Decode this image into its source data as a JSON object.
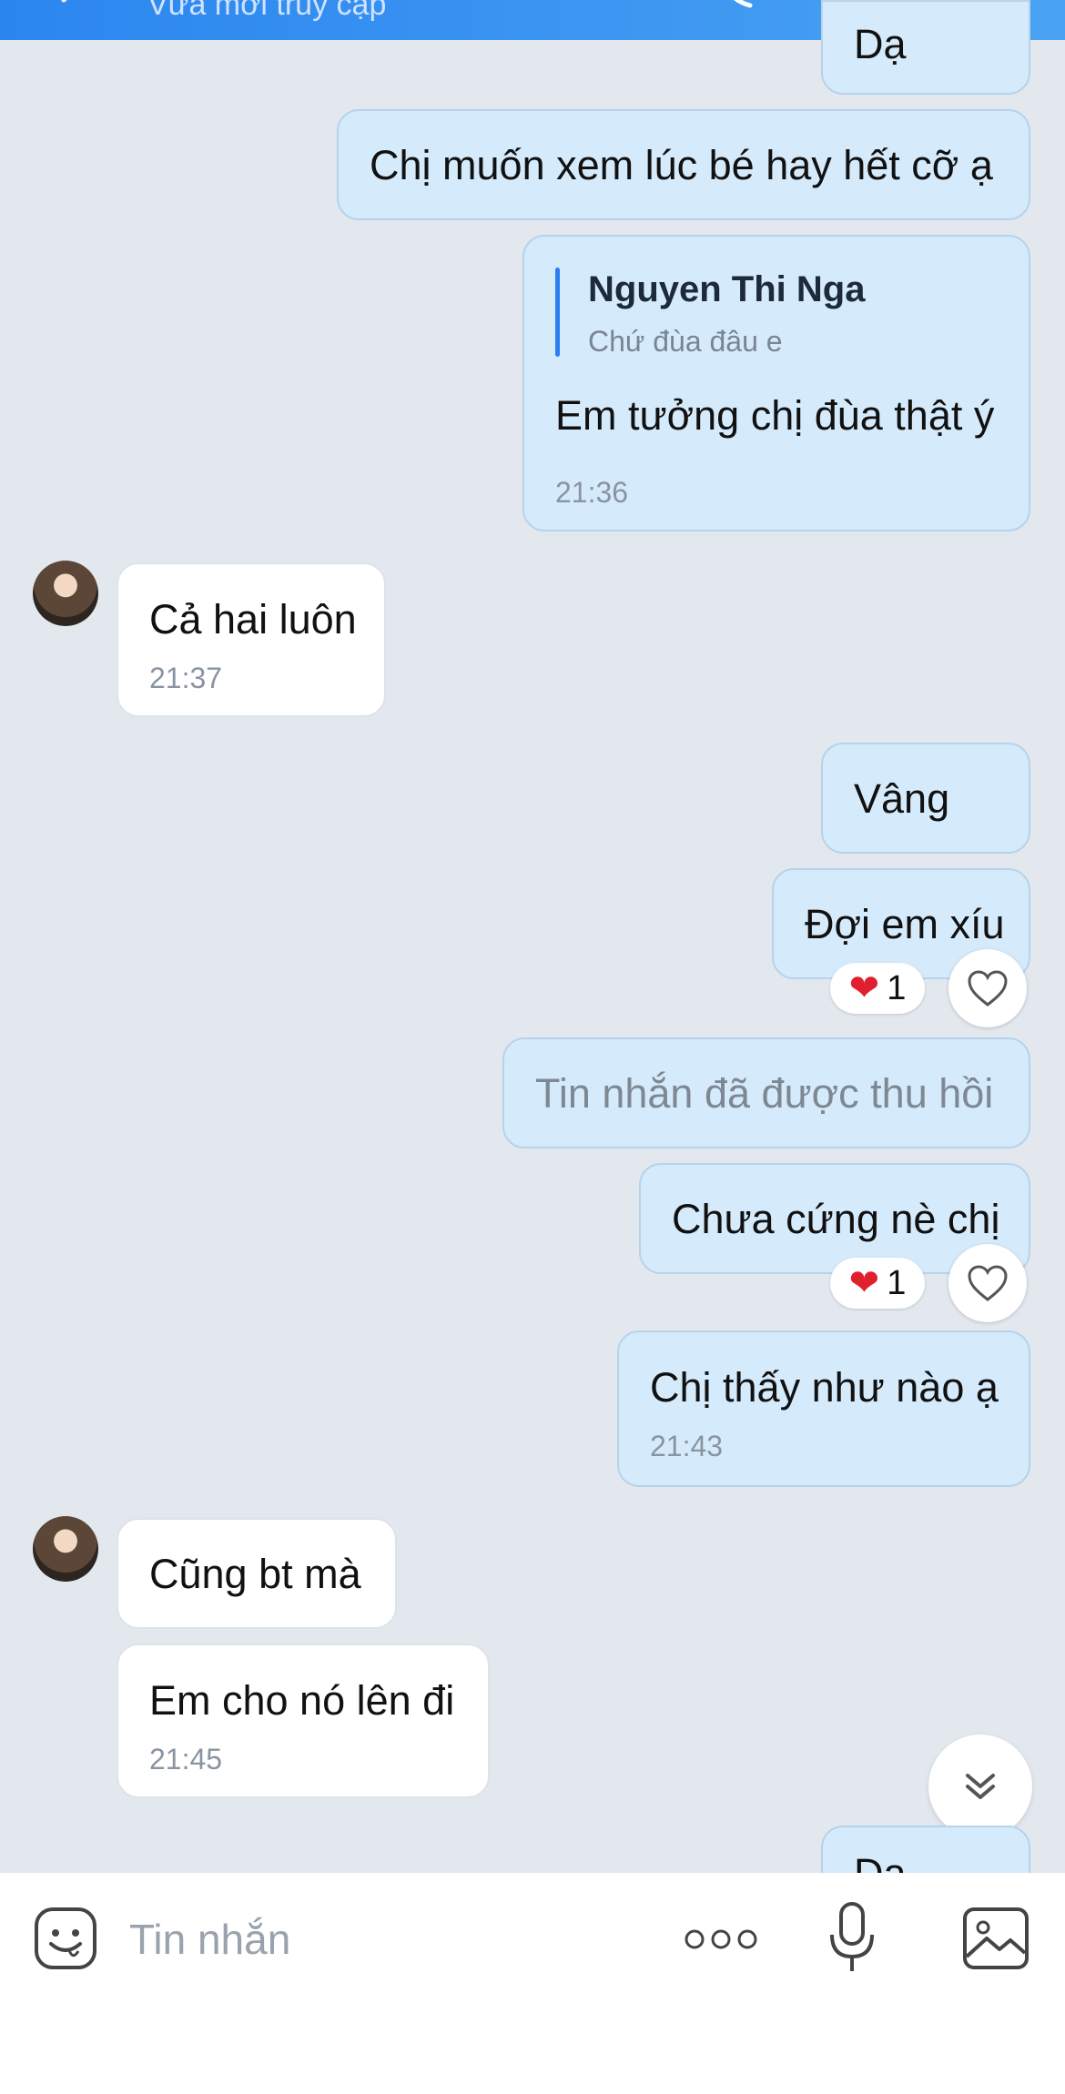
{
  "header": {
    "status_text": "Vừa mới truy cập"
  },
  "messages": {
    "m0_partial": "Dạ",
    "m1": "Chị muốn xem lúc bé hay hết cỡ ạ",
    "m2": {
      "quote_name": "Nguyen Thi Nga",
      "quote_text": "Chứ đùa đâu e",
      "text": "Em tưởng chị đùa thật ý",
      "time": "21:36"
    },
    "m3": {
      "text": "Cả hai luôn",
      "time": "21:37"
    },
    "m4": "Vâng",
    "m5": {
      "text": "Đợi em xíu",
      "reaction_count": "1"
    },
    "m6": "Tin nhắn đã được thu hồi",
    "m7": {
      "text": "Chưa cứng nè chị",
      "reaction_count": "1"
    },
    "m8": {
      "text": "Chị thấy như nào ạ",
      "time": "21:43"
    },
    "m9": "Cũng bt mà",
    "m10": {
      "text": "Em cho nó lên đi",
      "time": "21:45"
    },
    "m11_partial": "Dạ"
  },
  "composer": {
    "placeholder": "Tin nhắn"
  },
  "colors": {
    "header": "#2b86f0",
    "outgoing_bubble": "#d5ebfc",
    "incoming_bubble": "#ffffff",
    "background": "#e3e8ef",
    "heart": "#e0202f"
  },
  "icons": [
    "back-icon",
    "call-icon",
    "video-icon",
    "heart-reaction-icon",
    "like-heart-icon",
    "scroll-down-icon",
    "emoji-icon",
    "more-icon",
    "mic-icon",
    "image-icon"
  ]
}
